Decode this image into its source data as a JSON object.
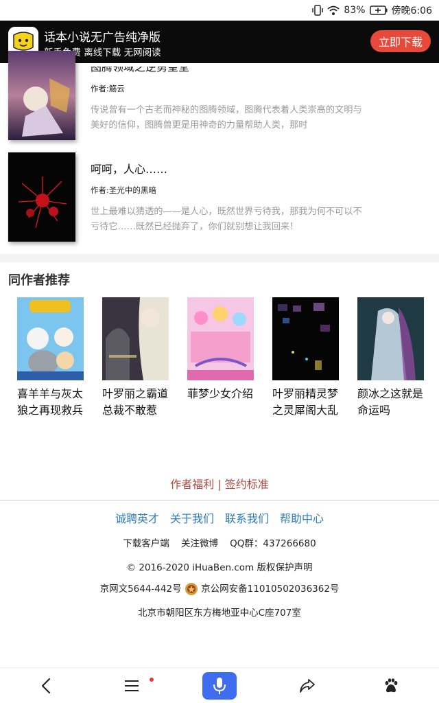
{
  "status_bar": {
    "battery": "83%",
    "time": "傍晚6:06"
  },
  "banner": {
    "title": "话本小说无广告纯净版",
    "subtitle": "新手免费 离线下载 无网阅读",
    "download_label": "立即下载"
  },
  "books": [
    {
      "title": "图腾领域之逆勇皇堂",
      "author": "作者:觞云",
      "desc": "传说曾有一个古老而神秘的图腾领域，图腾代表着人类崇高的文明与美好的信仰，图腾兽更是用神奇的力量帮助人类，那时"
    },
    {
      "title": "呵呵，人心……",
      "author": "作者:圣光中的黑暗",
      "desc": "世上最难以猜透的——是人心，既然世界亏待我，那我为何不可以不亏待它……既然已经抛弃了，你们就别想让我回来！"
    }
  ],
  "recommend": {
    "heading": "同作者推荐",
    "items": [
      {
        "title": "喜羊羊与灰太狼之再现救兵"
      },
      {
        "title": "叶罗丽之霸道总裁不敢惹"
      },
      {
        "title": "菲梦少女介绍"
      },
      {
        "title": "叶罗丽精灵梦之灵犀阁大乱"
      },
      {
        "title": "颜冰之这就是命运吗"
      }
    ]
  },
  "footer": {
    "welfare": "作者福利",
    "separator": "|",
    "sign": "签约标准",
    "links": [
      "诚聘英才",
      "关于我们",
      "联系我们",
      "帮助中心"
    ],
    "download_client": "下载客户端",
    "follow_weibo": "关注微博",
    "qq_group": "QQ群：437266680",
    "copyright": "© 2016-2020 iHuaBen.com 版权保护声明",
    "icp": "京网文5644-442号",
    "police": "京公网安备11010502036362号",
    "address": "北京市朝阳区东方梅地亚中心C座707室"
  },
  "colors": {
    "accent_red": "#e7493b",
    "link_blue": "#2e7bc4",
    "voice_blue": "#3e6df0"
  }
}
